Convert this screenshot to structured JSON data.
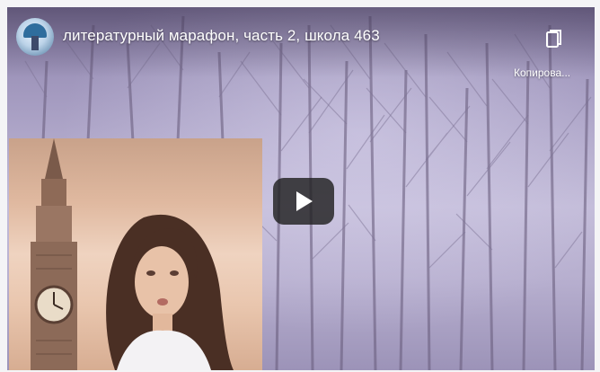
{
  "video": {
    "title": "литературный марафон, часть 2, школа 463",
    "channel_avatar_icon": "channel-avatar-icon",
    "copy_icon": "copy-link-icon",
    "copy_label": "Копирова...",
    "play_icon": "play-icon"
  },
  "colors": {
    "play_button_bg": "#212121",
    "overlay_text": "#ffffff"
  }
}
